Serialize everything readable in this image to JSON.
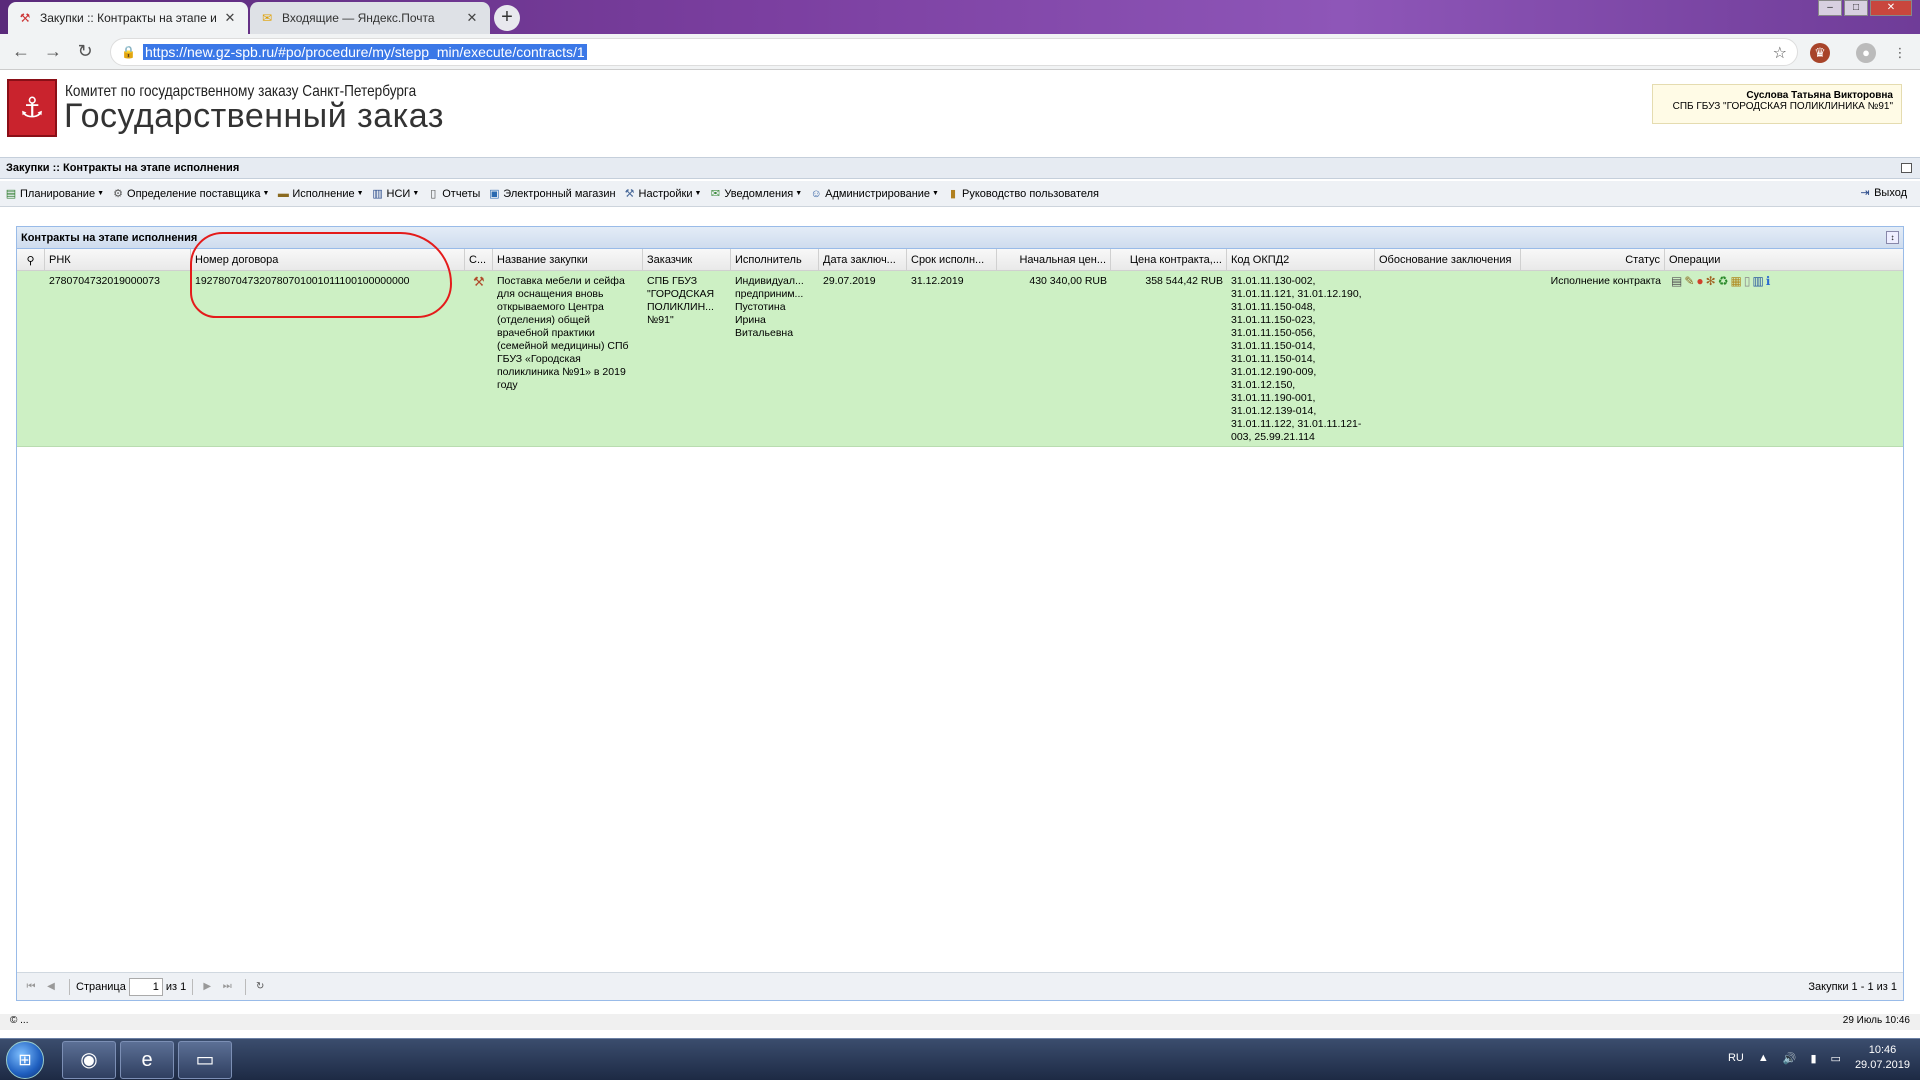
{
  "browser": {
    "tabs": [
      {
        "title": "Закупки :: Контракты на этапе и",
        "active": true
      },
      {
        "title": "Входящие — Яндекс.Почта",
        "active": false
      }
    ],
    "url": "https://new.gz-spb.ru/#po/procedure/my/stepp_min/execute/contracts/1"
  },
  "header": {
    "org": "Комитет по государственному заказу Санкт-Петербурга",
    "product": "Государственный заказ",
    "user_name": "Суслова Татьяна Викторовна",
    "user_org": "СПБ ГБУЗ \"ГОРОДСКАЯ ПОЛИКЛИНИКА №91\""
  },
  "page_title": "Закупки :: Контракты на этапе исполнения",
  "menu": {
    "items": [
      {
        "label": "Планирование",
        "icon": "planning-icon",
        "dropdown": true
      },
      {
        "label": "Определение поставщика",
        "icon": "gears-icon",
        "dropdown": true
      },
      {
        "label": "Исполнение",
        "icon": "truck-icon",
        "dropdown": true
      },
      {
        "label": "НСИ",
        "icon": "book-icon",
        "dropdown": true
      },
      {
        "label": "Отчеты",
        "icon": "report-icon",
        "dropdown": false
      },
      {
        "label": "Электронный магазин",
        "icon": "cart-icon",
        "dropdown": false
      },
      {
        "label": "Настройки",
        "icon": "wrench-icon",
        "dropdown": true
      },
      {
        "label": "Уведомления",
        "icon": "envelope-icon",
        "dropdown": true
      },
      {
        "label": "Администрирование",
        "icon": "user-icon",
        "dropdown": true
      },
      {
        "label": "Руководство пользователя",
        "icon": "manual-icon",
        "dropdown": false
      }
    ],
    "logout": "Выход"
  },
  "grid": {
    "title": "Контракты на этапе исполнения",
    "columns": [
      "РНК",
      "Номер договора",
      "С...",
      "Название закупки",
      "Заказчик",
      "Исполнитель",
      "Дата заключ...",
      "Срок исполн...",
      "Начальная цен...",
      "Цена контракта,...",
      "Код ОКПД2",
      "Обоснование заключения",
      "Статус",
      "Операции"
    ],
    "row": {
      "rnk": "2780704732019000073",
      "contract_no": "1927807047320780701001011100100000000",
      "name": "Поставка мебели и сейфа для оснащения вновь открываемого Центра (отделения) общей врачебной практики (семейной медицины) СПб ГБУЗ «Городская поликлиника №91» в 2019 году",
      "customer": "СПБ ГБУЗ \"ГОРОДСКАЯ ПОЛИКЛИН... №91\"",
      "executor": "Индивидуал... предприним... Пустотина Ирина Витальевна",
      "date_concluded": "29.07.2019",
      "deadline": "31.12.2019",
      "initial_price": "430 340,00 RUB",
      "contract_price": "358 544,42 RUB",
      "okpd": [
        "31.01.11.130-002,",
        "31.01.11.121, 31.01.12.190,",
        "31.01.11.150-048,",
        "31.01.11.150-023,",
        "31.01.11.150-056,",
        "31.01.11.150-014,",
        "31.01.11.150-014,",
        "31.01.12.190-009,",
        "31.01.12.150,",
        "31.01.11.190-001,",
        "31.01.12.139-014,",
        "31.01.11.122, 31.01.11.121-",
        "003, 25.99.21.114"
      ],
      "justification": "",
      "status": "Исполнение контракта"
    }
  },
  "paging": {
    "page_label": "Страница",
    "page": "1",
    "of_label": "из 1",
    "info": "Закупки 1 - 1 из 1"
  },
  "statusbar": {
    "left": "© ...",
    "right": "29 Июль 10:46"
  },
  "taskbar": {
    "lang": "RU",
    "time": "10:46",
    "date": "29.07.2019"
  }
}
